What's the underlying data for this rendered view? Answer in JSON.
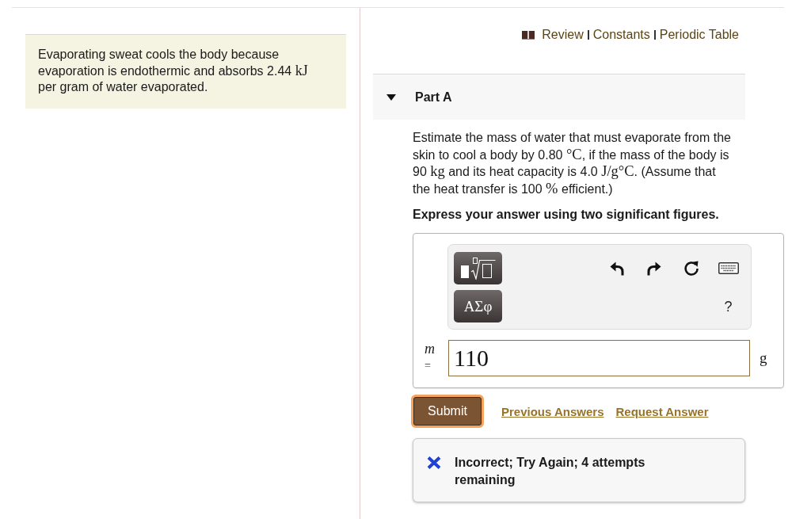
{
  "intro": [
    {
      "kind": "text",
      "text": "Evaporating sweat cools the body because evaporation is endothermic and absorbs 2.44 "
    },
    {
      "kind": "math",
      "text": "kJ"
    },
    {
      "kind": "text",
      "text": " per gram of water evaporated."
    }
  ],
  "resource_links": [
    "Review",
    "Constants",
    "Periodic Table"
  ],
  "part": {
    "title": "Part A",
    "expanded": true,
    "question": [
      {
        "kind": "text",
        "text": "Estimate the mass of water that must evaporate from the skin to cool a body by 0.80 "
      },
      {
        "kind": "math",
        "text": "°C"
      },
      {
        "kind": "text",
        "text": ", if the mass of the body is 90 "
      },
      {
        "kind": "math",
        "text": "kg"
      },
      {
        "kind": "text",
        "text": " and its heat capacity is 4.0 "
      },
      {
        "kind": "math",
        "text": "J/g°C"
      },
      {
        "kind": "text",
        "text": ". (Assume that the heat transfer is 100 "
      },
      {
        "kind": "math",
        "text": "%"
      },
      {
        "kind": "text",
        "text": " efficient.)"
      }
    ],
    "instruction": "Express your answer using two significant figures.",
    "toolbar": {
      "symbols_button": "ΑΣφ",
      "help_button": "?"
    },
    "answer": {
      "variable": "m",
      "equals": "=",
      "value": "110",
      "unit": "g"
    },
    "submit": {
      "label": "Submit",
      "focused": true
    },
    "links": [
      "Previous Answers",
      "Request Answer"
    ],
    "feedback": {
      "kind": "incorrect",
      "text": "Incorrect; Try Again; 4 attempts remaining"
    }
  }
}
